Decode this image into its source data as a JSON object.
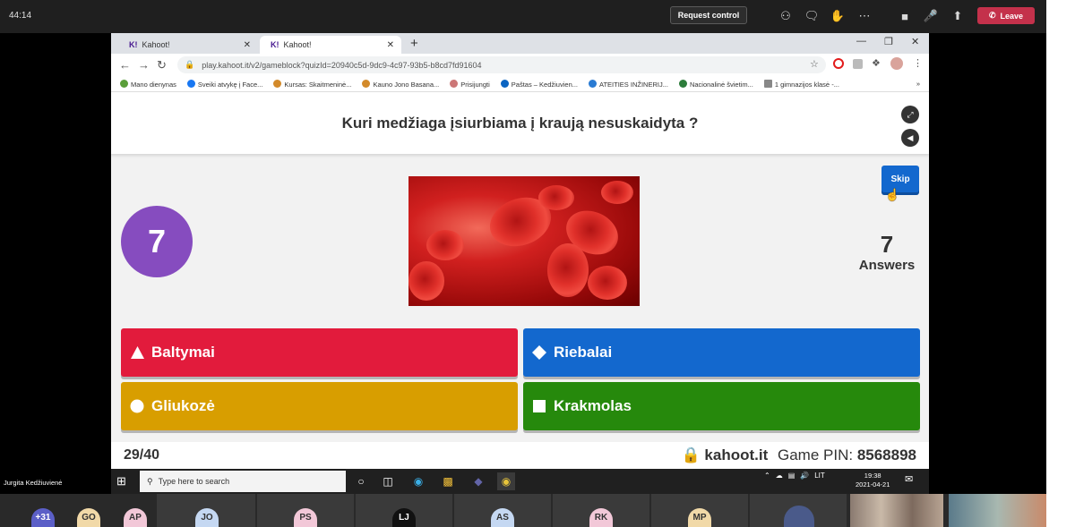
{
  "teams": {
    "timer": "44:14",
    "request_control": "Request control",
    "leave": "Leave",
    "presenter_name": "Jurgita Kedžiuvienė"
  },
  "browser": {
    "tabs": [
      {
        "title": "Kahoot!"
      },
      {
        "title": "Kahoot!"
      }
    ],
    "url": "play.kahoot.it/v2/gameblock?quizId=20940c5d-9dc9-4c97-93b5-b8cd7fd91604",
    "bookmarks": [
      "Mano dienynas",
      "Sveiki atvykę į Face...",
      "Kursas: Skaitmeninė...",
      "Kauno Jono Basana...",
      "Prisijungti",
      "Paštas – Kedžiuvien...",
      "ATEITIES INŽINERIJ...",
      "Nacionalinė švietim...",
      "1 gimnazijos klasė -..."
    ]
  },
  "kahoot": {
    "question": "Kuri medžiaga įsiurbiama į kraują nesuskaidyta ?",
    "skip": "Skip",
    "timer_value": "7",
    "answers_count": "7",
    "answers_label": "Answers",
    "options": [
      {
        "label": "Baltymai",
        "color": "#e21b3c",
        "shape": "triangle"
      },
      {
        "label": "Riebalai",
        "color": "#1368ce",
        "shape": "diamond"
      },
      {
        "label": "Gliukozė",
        "color": "#d89e00",
        "shape": "circle"
      },
      {
        "label": "Krakmolas",
        "color": "#26890c",
        "shape": "square"
      }
    ],
    "progress": "29/40",
    "site": "kahoot.it",
    "game_pin_label": "Game PIN:",
    "game_pin": "8568898"
  },
  "taskbar": {
    "search_placeholder": "Type here to search",
    "lang": "LIT",
    "time": "19:38",
    "date": "2021-04-21"
  },
  "participants": [
    "+31",
    "GO",
    "AP",
    "JO",
    "PS",
    "LJ",
    "AS",
    "RK",
    "MP"
  ]
}
